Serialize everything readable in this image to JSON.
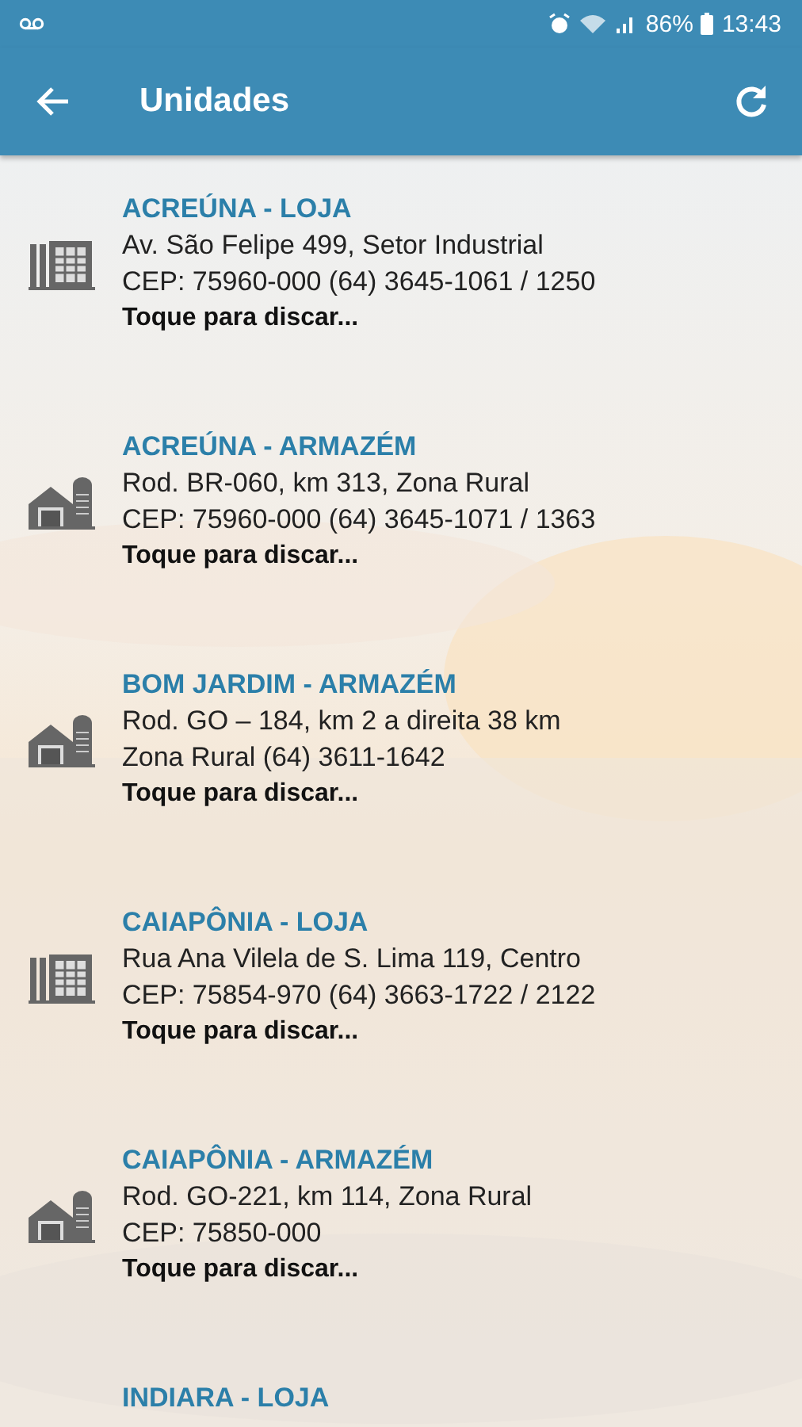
{
  "status_bar": {
    "battery": "86%",
    "time": "13:43"
  },
  "app_bar": {
    "title": "Unidades"
  },
  "units": [
    {
      "kind": "loja",
      "name": "ACREÚNA - LOJA",
      "lines": [
        "Av. São Felipe 499, Setor Industrial",
        "CEP: 75960-000 (64) 3645-1061 / 1250"
      ],
      "action": "Toque para discar..."
    },
    {
      "kind": "armazem",
      "name": "ACREÚNA - ARMAZÉM",
      "lines": [
        "Rod. BR-060, km 313, Zona Rural",
        "CEP: 75960-000 (64) 3645-1071 / 1363"
      ],
      "action": "Toque para discar..."
    },
    {
      "kind": "armazem",
      "name": "BOM JARDIM - ARMAZÉM",
      "lines": [
        "Rod. GO – 184, km 2 a direita 38 km",
        "Zona Rural (64) 3611-1642"
      ],
      "action": "Toque para discar..."
    },
    {
      "kind": "loja",
      "name": "CAIAPÔNIA - LOJA",
      "lines": [
        "Rua Ana Vilela de S. Lima 119, Centro",
        "CEP: 75854-970 (64) 3663-1722 / 2122"
      ],
      "action": "Toque para discar..."
    },
    {
      "kind": "armazem",
      "name": "CAIAPÔNIA - ARMAZÉM",
      "lines": [
        "Rod. GO-221, km 114, Zona Rural",
        "CEP: 75850-000"
      ],
      "action": "Toque para discar..."
    },
    {
      "name": "INDIARA - LOJA"
    }
  ]
}
